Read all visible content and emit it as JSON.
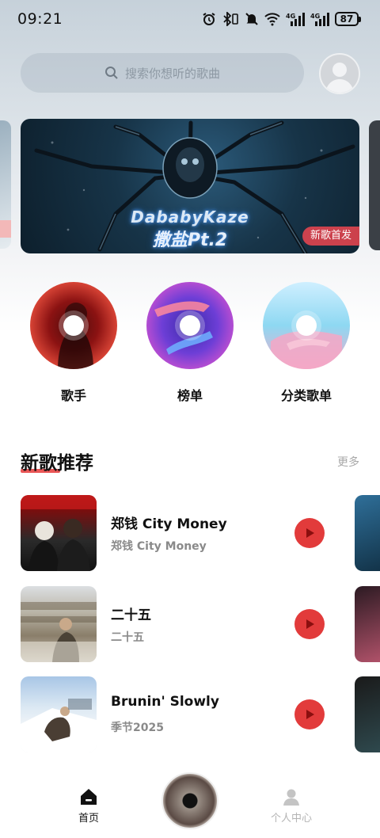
{
  "status_bar": {
    "time": "09:21",
    "battery": "87",
    "network_1": "4G",
    "network_2": "4G"
  },
  "search": {
    "placeholder": "搜索你想听的歌曲"
  },
  "banner": {
    "title": "DababyKaze",
    "subtitle": "撒盐Pt.2",
    "badge": "新歌首发"
  },
  "categories": [
    {
      "label": "歌手"
    },
    {
      "label": "榜单"
    },
    {
      "label": "分类歌单"
    }
  ],
  "section": {
    "title": "新歌推荐",
    "more": "更多",
    "accent_color": "#e63a3a"
  },
  "songs": [
    {
      "title": "郑钱 City Money",
      "subtitle": "郑钱 City Money"
    },
    {
      "title": "二十五",
      "subtitle": "二十五"
    },
    {
      "title": "Brunin' Slowly",
      "subtitle": "季节2025"
    }
  ],
  "nav": {
    "home": "首页",
    "profile": "个人中心"
  },
  "colors": {
    "play_button": "#e23b3b",
    "badge": "#e64650"
  }
}
